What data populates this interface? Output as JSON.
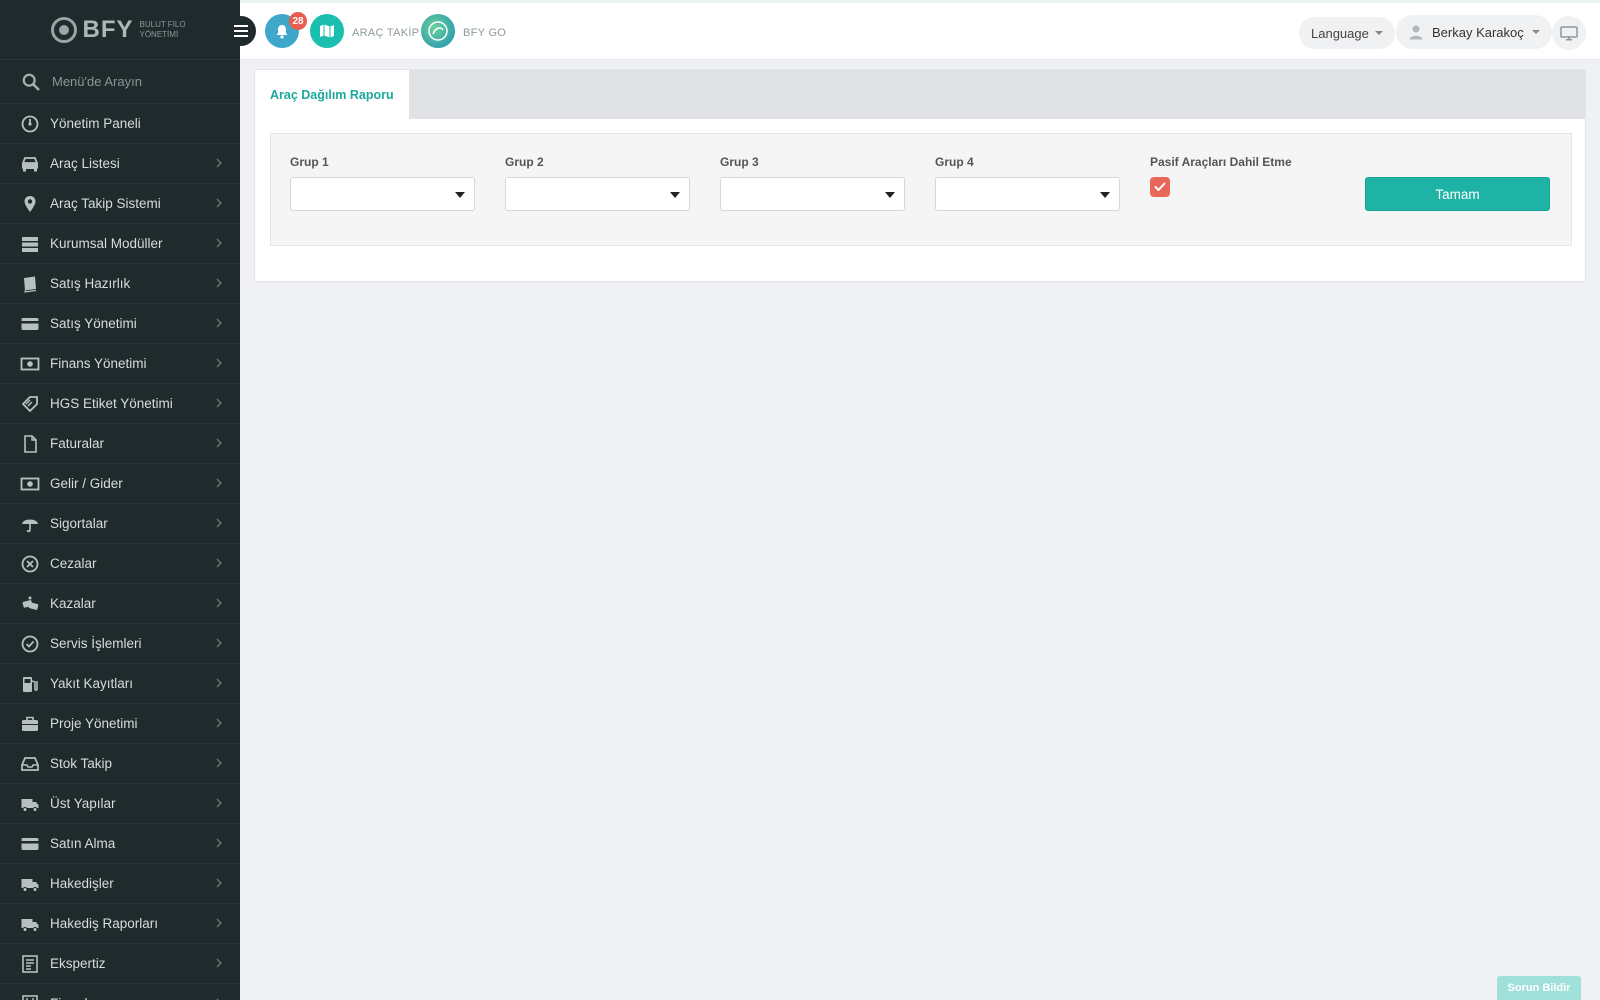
{
  "brand": {
    "name": "BFY",
    "subtitle": "BULUT FİLO YÖNETİMİ"
  },
  "sidebar": {
    "search_placeholder": "Menü'de Arayın",
    "items": [
      {
        "label": "Yönetim Paneli",
        "icon": "dashboard-icon",
        "has_submenu": false
      },
      {
        "label": "Araç Listesi",
        "icon": "car-icon",
        "has_submenu": true
      },
      {
        "label": "Araç Takip Sistemi",
        "icon": "map-pin-icon",
        "has_submenu": true
      },
      {
        "label": "Kurumsal Modüller",
        "icon": "server-icon",
        "has_submenu": true
      },
      {
        "label": "Satış Hazırlık",
        "icon": "book-icon",
        "has_submenu": true
      },
      {
        "label": "Satış Yönetimi",
        "icon": "credit-card-icon",
        "has_submenu": true
      },
      {
        "label": "Finans Yönetimi",
        "icon": "money-icon",
        "has_submenu": true
      },
      {
        "label": "HGS Etiket Yönetimi",
        "icon": "tag-icon",
        "has_submenu": true
      },
      {
        "label": "Faturalar",
        "icon": "file-icon",
        "has_submenu": true
      },
      {
        "label": "Gelir / Gider",
        "icon": "money-icon",
        "has_submenu": true
      },
      {
        "label": "Sigortalar",
        "icon": "umbrella-icon",
        "has_submenu": true
      },
      {
        "label": "Cezalar",
        "icon": "x-circle-icon",
        "has_submenu": true
      },
      {
        "label": "Kazalar",
        "icon": "car-crash-icon",
        "has_submenu": true
      },
      {
        "label": "Servis İşlemleri",
        "icon": "check-circle-icon",
        "has_submenu": true
      },
      {
        "label": "Yakıt Kayıtları",
        "icon": "fuel-icon",
        "has_submenu": true
      },
      {
        "label": "Proje Yönetimi",
        "icon": "briefcase-icon",
        "has_submenu": true
      },
      {
        "label": "Stok Takip",
        "icon": "inbox-icon",
        "has_submenu": true
      },
      {
        "label": "Üst Yapılar",
        "icon": "truck-icon",
        "has_submenu": true
      },
      {
        "label": "Satın Alma",
        "icon": "credit-card-icon",
        "has_submenu": true
      },
      {
        "label": "Hakedişler",
        "icon": "truck-icon",
        "has_submenu": true
      },
      {
        "label": "Hakediş Raporları",
        "icon": "truck-icon",
        "has_submenu": true
      },
      {
        "label": "Ekspertiz",
        "icon": "report-icon",
        "has_submenu": true
      },
      {
        "label": "Firmalar",
        "icon": "building-icon",
        "has_submenu": true
      }
    ]
  },
  "header": {
    "notification_count": "28",
    "arac_takip_label": "ARAÇ TAKİP",
    "bfy_go_label": "BFY GO",
    "language_label": "Language",
    "user_name": "Berkay Karakoç"
  },
  "main": {
    "tab_label": "Araç Dağılım Raporu",
    "filters": {
      "group1_label": "Grup 1",
      "group2_label": "Grup 2",
      "group3_label": "Grup 3",
      "group4_label": "Grup 4",
      "exclude_passive_label": "Pasif Araçları Dahil Etme",
      "exclude_passive_checked": true
    },
    "submit_label": "Tamam"
  },
  "footer": {
    "report_issue_label": "Sorun Bildir"
  },
  "colors": {
    "sidebar_bg": "#1f2a2c",
    "accent": "#1fb3a6",
    "badge": "#e85d4f",
    "checkbox": "#e8675b"
  }
}
